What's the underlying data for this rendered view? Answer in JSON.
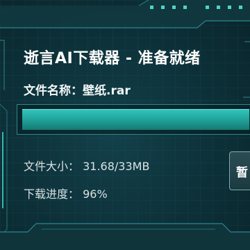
{
  "window": {
    "title": "逝言AI下载器 - 准备就绪"
  },
  "file": {
    "name_label": "文件名称：",
    "name_value": "壁纸.rar",
    "size_label": "文件大小：",
    "size_value": "31.68/33MB",
    "progress_label": "下载进度：",
    "progress_value": "96%"
  },
  "progress": {
    "fraction": 0.96
  },
  "side_button": {
    "label": "暂"
  },
  "colors": {
    "background": "#0d3038",
    "accent": "#2fc4bb",
    "frame_line": "#2c8792"
  }
}
